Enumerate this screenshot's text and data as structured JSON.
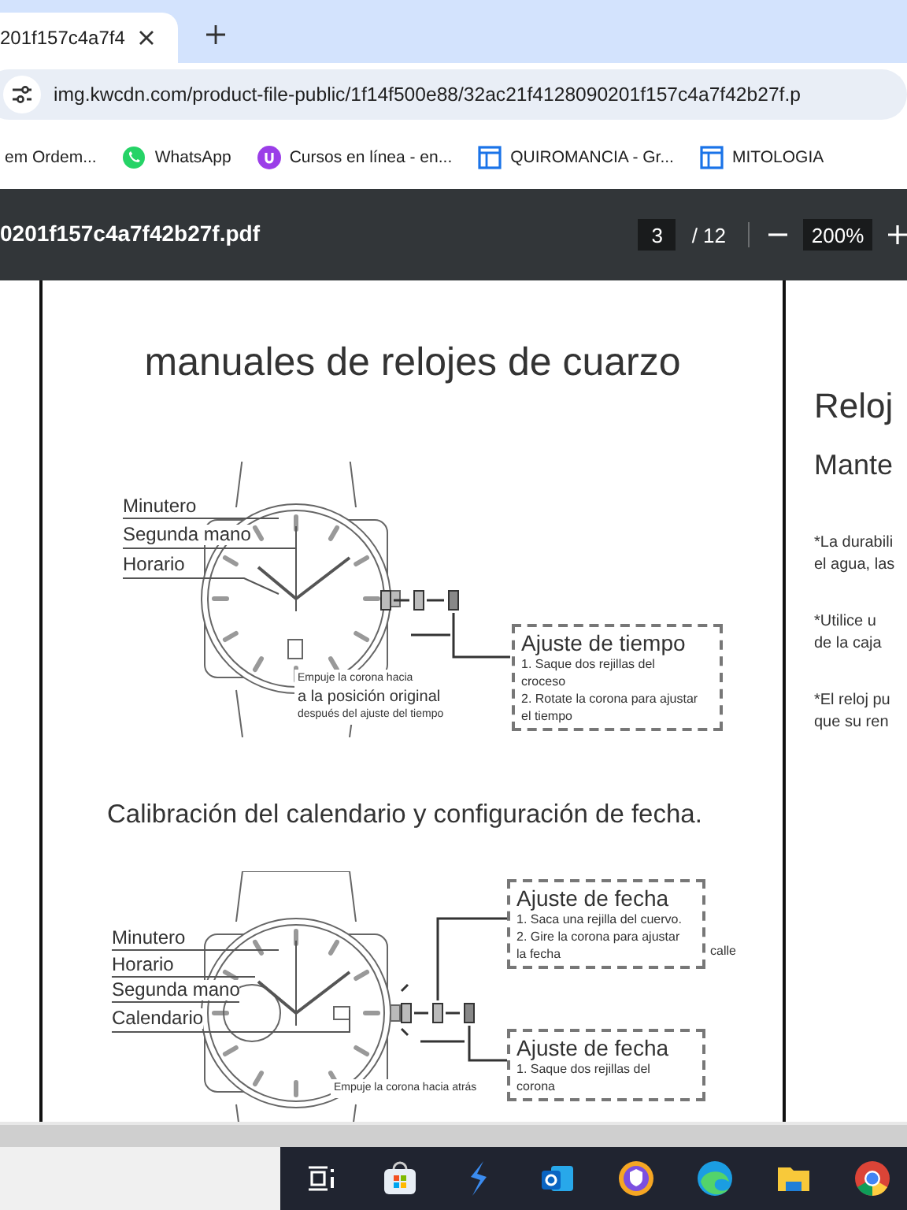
{
  "browser": {
    "tab": {
      "title": "201f157c4a7f4",
      "selected": true
    },
    "address": "img.kwcdn.com/product-file-public/1f14f500e88/32ac21f4128090201f157c4a7f42b27f.p",
    "bookmarks": [
      {
        "label": "em Ordem...",
        "kind": "plain"
      },
      {
        "label": "WhatsApp",
        "kind": "chat"
      },
      {
        "label": "Cursos en línea - en...",
        "kind": "course"
      },
      {
        "label": "QUIROMANCIA - Gr...",
        "kind": "doc"
      },
      {
        "label": "MITOLOGIA",
        "kind": "doc"
      }
    ]
  },
  "pdf_toolbar": {
    "file_name": "0201f157c4a7f42b27f.pdf",
    "page": "3",
    "page_count": "/ 12",
    "zoom": "200%"
  },
  "page_left": {
    "title": "manuales de relojes de cuarzo",
    "diagram_1": {
      "labels": [
        "Minutero",
        "Segunda mano",
        "Horario"
      ],
      "box": {
        "title": "Ajuste de tiempo",
        "lines": [
          "1. Saque dos rejillas del",
          "croceso",
          "2. Rotate la corona para ajustar",
          "el tiempo"
        ]
      },
      "note": [
        "Empuje la corona hacia",
        "a la posición original",
        "después del ajuste del tiempo"
      ]
    },
    "heading": "Calibración del calendario y configuración de fecha.",
    "diagram_2": {
      "labels": [
        "Minutero",
        "Horario",
        "Segunda mano",
        "Calendario"
      ],
      "box_1": {
        "title": "Ajuste de fecha",
        "lines": [
          "1. Saca una rejilla del cuervo.",
          "2. Gire la corona para ajustar",
          "la fecha"
        ]
      },
      "side_note": "calle",
      "box_2": {
        "title": "Ajuste de fecha",
        "lines": [
          "1. Saque dos rejillas del",
          "corona"
        ]
      },
      "note": [
        "Empuje la corona hacia atrás"
      ]
    }
  },
  "page_right": {
    "title": "Reloj",
    "subtitle": "Mante",
    "paragraphs": [
      [
        "*La durabili",
        "el agua, las"
      ],
      [
        "*Utilice u",
        "de la caja"
      ],
      [
        "*El reloj pu",
        "que su ren"
      ]
    ]
  }
}
